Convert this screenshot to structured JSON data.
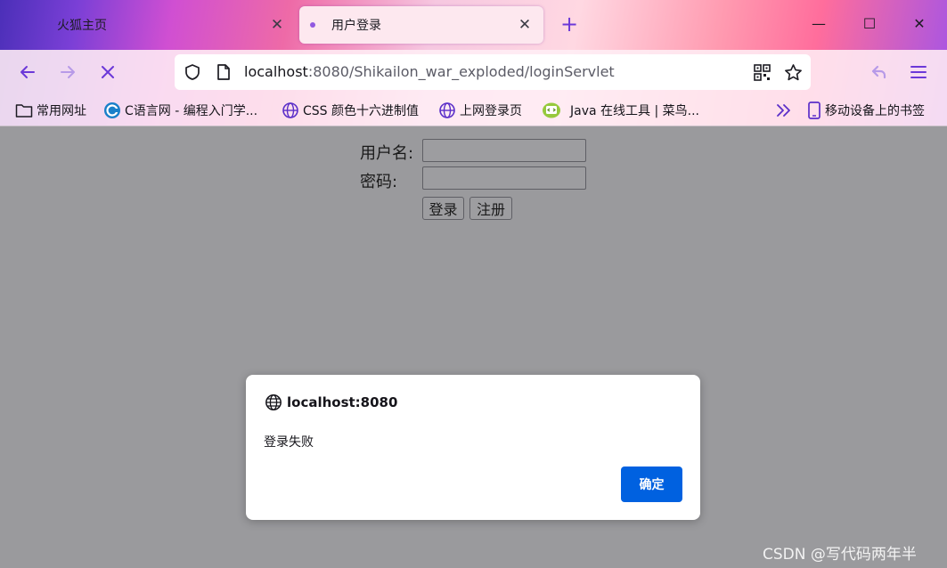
{
  "browser": {
    "tabs": [
      {
        "label": "火狐主页",
        "active": false
      },
      {
        "label": "用户登录",
        "active": true
      }
    ],
    "new_tab": "+",
    "window_controls": {
      "minimize": "—",
      "maximize": "☐",
      "close": "✕"
    },
    "url": {
      "host": "localhost",
      "rest": ":8080/Shikailon_war_exploded/loginServlet"
    },
    "bookmarks": [
      {
        "label": "常用网址",
        "icon": "folder-icon"
      },
      {
        "label": "C语言网 - 编程入门学...",
        "icon": "dotcpp-icon"
      },
      {
        "label": "CSS 颜色十六进制值",
        "icon": "globe-icon"
      },
      {
        "label": "上网登录页",
        "icon": "globe-icon"
      },
      {
        "label": "Java 在线工具 | 菜鸟...",
        "icon": "runoob-icon"
      },
      {
        "label": "移动设备上的书签",
        "icon": "mobile-icon"
      }
    ],
    "accent_color": "#6b38d8"
  },
  "page": {
    "username_label": "用户名:",
    "password_label": "密码:",
    "login_button": "登录",
    "register_button": "注册"
  },
  "dialog": {
    "origin": "localhost:8080",
    "message": "登录失败",
    "ok_button": "确定",
    "ok_color": "#0061e0"
  },
  "watermark": "CSDN @写代码两年半"
}
